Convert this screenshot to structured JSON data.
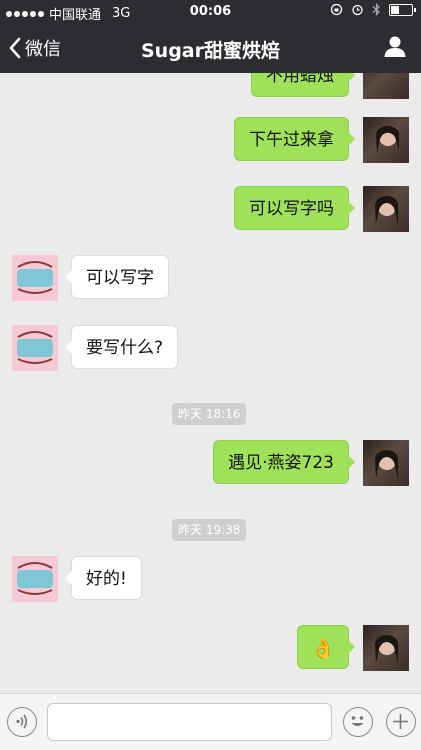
{
  "status_bar": {
    "carrier": "中国联通",
    "network": "3G",
    "time": "00:06",
    "battery_level": 0.4
  },
  "nav": {
    "back_label": "微信",
    "title": "Sugar甜蜜烘焙"
  },
  "messages": [
    {
      "side": "mine",
      "text": "不用蜡烛"
    },
    {
      "side": "mine",
      "text": "下午过来拿"
    },
    {
      "side": "mine",
      "text": "可以写字吗"
    },
    {
      "side": "theirs",
      "text": "可以写字"
    },
    {
      "side": "theirs",
      "text": "要写什么?"
    },
    {
      "timestamp": "昨天 18:16"
    },
    {
      "side": "mine",
      "text": "遇见·燕姿723"
    },
    {
      "timestamp": "昨天 19:38"
    },
    {
      "side": "theirs",
      "text": "好的!"
    },
    {
      "side": "mine",
      "emoji": "👌"
    }
  ],
  "input_bar": {
    "voice_icon": "voice-icon",
    "emoji_icon": "smiley-icon",
    "plus_icon": "plus-icon",
    "placeholder": ""
  },
  "colors": {
    "nav_bg": "#2c2d31",
    "chat_bg": "#ebebeb",
    "my_bubble": "#9fe25a",
    "their_bubble": "#ffffff"
  }
}
